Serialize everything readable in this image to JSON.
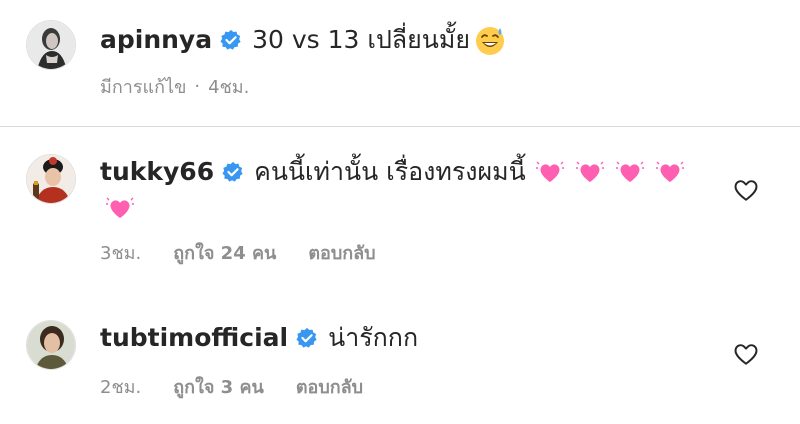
{
  "caption": {
    "username": "apinnya",
    "text": "30 vs 13 เปลี่ยนมั้ย",
    "emoji": "sweat-smile-emoji",
    "edited_label": "มีการแก้ไข",
    "separator": "·",
    "time": "4ชม."
  },
  "comments": [
    {
      "username": "tukky66",
      "text": "คนนี้เท่านั้น เรื่องทรงผมนี้",
      "heart_emoji_count": 5,
      "time": "3ชม.",
      "likes": "ถูกใจ 24 คน",
      "reply_label": "ตอบกลับ"
    },
    {
      "username": "tubtimofficial",
      "text": "น่ารักกก",
      "time": "2ชม.",
      "likes": "ถูกใจ 3 คน",
      "reply_label": "ตอบกลับ"
    }
  ],
  "colors": {
    "verified": "#3897f0",
    "muted": "#8e8e8e",
    "text": "#262626",
    "heart_pink": "#ff5fb1"
  }
}
